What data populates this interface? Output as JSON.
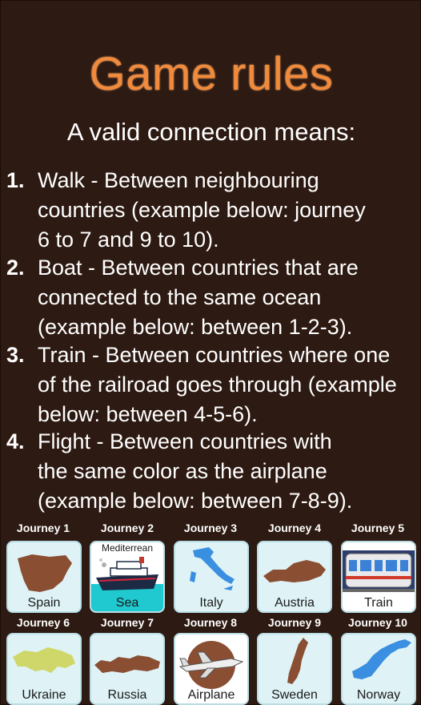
{
  "title": "Game rules",
  "subtitle": "A valid connection means:",
  "rules": [
    {
      "num": "1.",
      "text": "Walk - Between neighbouring\ncountries (example below: journey\n6 to 7 and 9 to 10)."
    },
    {
      "num": "2.",
      "text": "Boat - Between countries that are\nconnected to the same ocean\n(example below: between 1-2-3)."
    },
    {
      "num": "3.",
      "text": "Train - Between countries where one\nof the railroad goes through (example\nbelow: between 4-5-6)."
    },
    {
      "num": "4.",
      "text": "Flight - Between countries with\nthe same color as the airplane\n(example below: between 7-8-9)."
    }
  ],
  "journeys": [
    {
      "title": "Journey 1",
      "label": "Spain",
      "icon": "spain-map-icon",
      "color": "#8a4e33"
    },
    {
      "title": "Journey 2",
      "label": "Sea",
      "top_label": "Mediterrean",
      "icon": "ship-icon",
      "color": "#1fc9cf"
    },
    {
      "title": "Journey 3",
      "label": "Italy",
      "icon": "italy-map-icon",
      "color": "#3a8fe0"
    },
    {
      "title": "Journey 4",
      "label": "Austria",
      "icon": "austria-map-icon",
      "color": "#8a4e33"
    },
    {
      "title": "Journey 5",
      "label": "Train",
      "icon": "train-icon",
      "color": "#3b82d6"
    },
    {
      "title": "Journey 6",
      "label": "Ukraine",
      "icon": "ukraine-map-icon",
      "color": "#cfd76a"
    },
    {
      "title": "Journey 7",
      "label": "Russia",
      "icon": "russia-map-icon",
      "color": "#8a4e33"
    },
    {
      "title": "Journey 8",
      "label": "Airplane",
      "icon": "airplane-icon",
      "color": "#8a4e33"
    },
    {
      "title": "Journey 9",
      "label": "Sweden",
      "icon": "sweden-map-icon",
      "color": "#8a4e33"
    },
    {
      "title": "Journey 10",
      "label": "Norway",
      "icon": "norway-map-icon",
      "color": "#3a8fe0"
    }
  ]
}
